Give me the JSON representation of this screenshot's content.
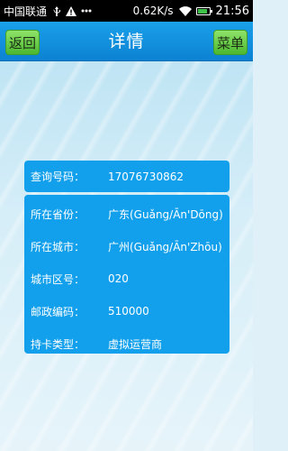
{
  "status_bar": {
    "carrier": "中国联通",
    "speed": "0.62K/s",
    "time": "21:56",
    "battery_level": 0.85,
    "icons": [
      "usb-icon",
      "warning-icon",
      "more-icon",
      "wifi-icon",
      "battery-icon"
    ]
  },
  "header": {
    "title": "详情",
    "back_label": "返回",
    "menu_label": "菜单"
  },
  "query": {
    "label": "查询号码：",
    "value": "17076730862"
  },
  "details": [
    {
      "label": "所在省份：",
      "value": "广东(Guǎng/Ān'Dōng)"
    },
    {
      "label": "所在城市：",
      "value": "广州(Guǎng/Ān'Zhōu)"
    },
    {
      "label": "城市区号：",
      "value": "020"
    },
    {
      "label": "邮政编码：",
      "value": "510000"
    },
    {
      "label": "持卡类型：",
      "value": "虚拟运营商"
    }
  ],
  "colors": {
    "header": "#1aa0ea",
    "card": "#12a0ec",
    "button": "#6fd04a",
    "background": "#d6eef8"
  }
}
